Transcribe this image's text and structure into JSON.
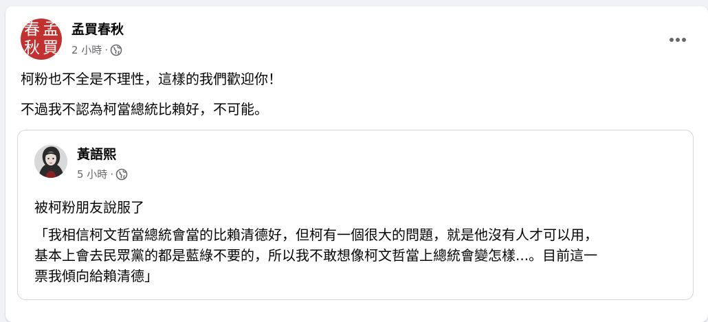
{
  "post": {
    "page_name": "孟買春秋",
    "avatar_chars": [
      "春",
      "孟",
      "秋",
      "買"
    ],
    "time": "2 小時",
    "dot": "·",
    "lines": [
      "柯粉也不全是不理性，這樣的我們歡迎你！",
      "不過我不認為柯當總統比賴好，不可能。"
    ]
  },
  "shared_post": {
    "author": "黃語熙",
    "time": "5 小時",
    "dot": "·",
    "lines": [
      "被柯粉朋友說服了",
      "「我相信柯文哲當總統會當的比賴清德好，但柯有一個很大的問題，就是他沒有人才可以用，",
      "基本上會去民眾黨的都是藍綠不要的，所以我不敢想像柯文哲當上總統會變怎樣...。目前這一",
      "票我傾向給賴清德」"
    ]
  },
  "icons": {
    "globe": "globe-icon",
    "more": "more-options-icon"
  },
  "colors": {
    "avatar_red": "#c2302f",
    "meta_gray": "#65676b",
    "text": "#050505"
  }
}
